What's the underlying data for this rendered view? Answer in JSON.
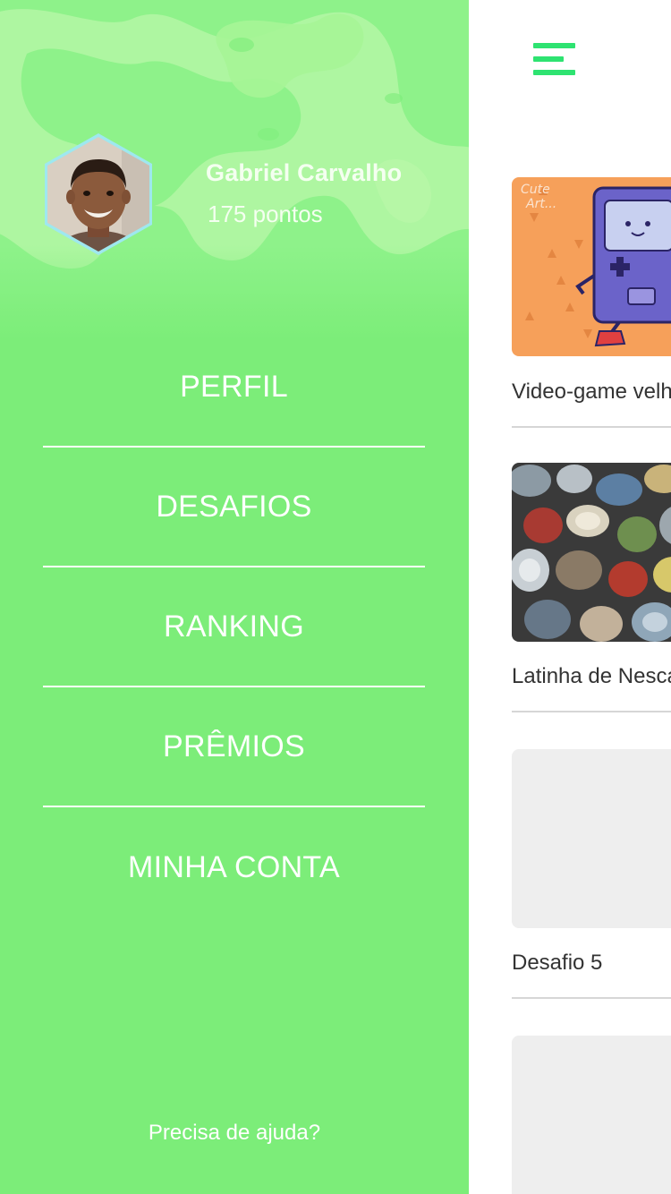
{
  "colors": {
    "drawer_bg": "#7ced79",
    "accent": "#2ee371",
    "text_white": "#ffffff",
    "placeholder_bg": "#eeeeee"
  },
  "user": {
    "name": "Gabriel Carvalho",
    "points": "175 pontos"
  },
  "menu": {
    "items": [
      {
        "label": "PERFIL"
      },
      {
        "label": "DESAFIOS"
      },
      {
        "label": "RANKING"
      },
      {
        "label": "PRÊMIOS"
      },
      {
        "label": "MINHA CONTA"
      }
    ]
  },
  "help_link": "Precisa de ajuda?",
  "header": {
    "menu_icon": "hamburger-icon"
  },
  "challenges": [
    {
      "title": "Video-game velho",
      "image": "videogame-cartoon"
    },
    {
      "title": "Latinha de Nescau",
      "image": "tin-cans-photo"
    },
    {
      "title": "Desafio 5",
      "image": "placeholder"
    },
    {
      "title": "",
      "image": "placeholder"
    }
  ]
}
